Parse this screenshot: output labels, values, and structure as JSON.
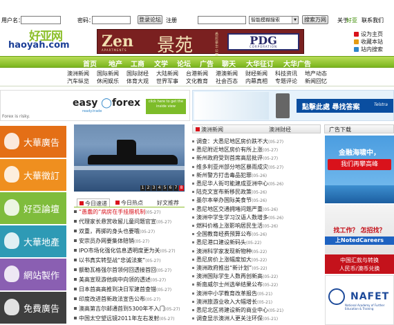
{
  "login": {
    "username_label": "用户名：",
    "password_label": "密码：",
    "login_button": "登录论坛",
    "register_link": "注册",
    "search_select": "智能模糊搜索",
    "search_button": "搜索万网",
    "about_label": "关于",
    "about_link": "好亚",
    "contact_link": "联系我们"
  },
  "logo": {
    "cn": "好亚网",
    "en": "haoyah.com"
  },
  "banner": {
    "zen_en": "Zen",
    "zen_sub": "APARTMENTS",
    "zen_cn": "景苑",
    "zen_vertical": "悉尼豪华公寓",
    "pdg_title": "PDG",
    "pdg_sub": "CORPORATION"
  },
  "quick_links": [
    "设为主页",
    "收藏本站",
    "站内搜索"
  ],
  "nav": [
    "首页",
    "地产",
    "工商",
    "文学",
    "论坛",
    "广告",
    "聊天",
    "大华征订",
    "大华广告"
  ],
  "subnav": {
    "row1": [
      "澳洲新闻",
      "国际新闻",
      "国际财经",
      "大陆新闻",
      "台港新闻",
      "港澳新闻",
      "财经新闻",
      "科技资讯",
      "地产动态"
    ],
    "row2": [
      "汽车纵览",
      "休闲娱乐",
      "体育大观",
      "世界军事",
      "文化教育",
      "社会百态",
      "内幕真相",
      "专题评论",
      "新闻回忆"
    ]
  },
  "forex_ad": {
    "brand_a": "easy",
    "brand_b": "forex",
    "tagline": "ready.trade",
    "cta": "click here to get the inside view",
    "risk": "Forex is risky."
  },
  "telstra_ad": {
    "text": "點擊此處 尋找答案",
    "brand": "Telstra"
  },
  "left_menu": [
    {
      "label": "大華廣告",
      "color": "#e46f16"
    },
    {
      "label": "大華徵訂",
      "color": "#ef8f1f"
    },
    {
      "label": "好亞論壇",
      "color": "#7fbc3c"
    },
    {
      "label": "大華地產",
      "color": "#2e9ab5"
    },
    {
      "label": "網站製作",
      "color": "#8a5fb2"
    },
    {
      "label": "免費廣告",
      "color": "#3f3f3f"
    }
  ],
  "photo": {
    "pages": [
      "1",
      "2",
      "3",
      "4",
      "5",
      "6",
      "7",
      "8"
    ],
    "active_page": "8"
  },
  "left_tabs": [
    "今日速递",
    "今日热点",
    "好文推荐"
  ],
  "left_news": [
    {
      "title": "“愚蠢的”病房在手挂腊机制",
      "date": "(05-27)"
    },
    {
      "title": "代理家长悬赏收留儿童问题官宣",
      "date": "(05-27)"
    },
    {
      "title": "双重，再掷的身头也要哦",
      "date": "(05-27)"
    },
    {
      "title": "安宗员办网要集体赔销",
      "date": "(05-27)"
    },
    {
      "title": "IPO市场化强化信息透明度更为关",
      "date": "(05-27)"
    },
    {
      "title": "以书真实转型战“忠诚法案”",
      "date": "(05-27)"
    },
    {
      "title": "额勒瓦格强尔首领何回透接首回",
      "date": "(05-27)"
    },
    {
      "title": "美高宣现游他病中向领的透述",
      "date": "(05-27)"
    },
    {
      "title": "日本首高高推到决日军建首查错",
      "date": "(05-27)"
    },
    {
      "title": "印度改进首新政法宣告公布",
      "date": "(05-27)"
    },
    {
      "title": "澳高第吉尔邮通首到5300年不入门",
      "date": "(05-27)"
    },
    {
      "title": "中国太空望远镜2011年左右发射",
      "date": "(05-27)"
    }
  ],
  "mid_tabs": [
    "澳洲新闻",
    "澳洲财经"
  ],
  "mid_news": [
    {
      "title": "调查：大悉尼地区房价跌不大",
      "date": "(05-27)"
    },
    {
      "title": "悉尼附近地区房价有所上涨",
      "date": "(05-27)"
    },
    {
      "title": "新州政府受到首席高层批评",
      "date": "(05-27)"
    },
    {
      "title": "维多利亚州部分地区暴雨成灾",
      "date": "(05-27)"
    },
    {
      "title": "新州警方打击毒品犯罪",
      "date": "(05-26)"
    },
    {
      "title": "悉尼华人街可能建成亚洲中心",
      "date": "(05-26)"
    },
    {
      "title": "陆克文宣布新移民政策",
      "date": "(05-26)"
    },
    {
      "title": "墨尔本举办国际美食节",
      "date": "(05-26)"
    },
    {
      "title": "悉尼地区交通拥堵问题严重",
      "date": "(05-26)"
    },
    {
      "title": "澳洲中学生学习汉语人数增多",
      "date": "(05-26)"
    },
    {
      "title": "燃料价格上涨影响居民生活",
      "date": "(05-26)"
    },
    {
      "title": "全国教育经费预算公布",
      "date": "(05-26)"
    },
    {
      "title": "悉尼港口建设新码头",
      "date": "(05-22)"
    },
    {
      "title": "澳洲科学家发现新物种",
      "date": "(05-22)"
    },
    {
      "title": "悉尼房价上涨幅度加大",
      "date": "(05-22)"
    },
    {
      "title": "澳洲政府推出“新计划”",
      "date": "(05-22)"
    },
    {
      "title": "澳洲国际学生人数再创新高",
      "date": "(05-22)"
    },
    {
      "title": "新南威尔士州选举结果公布",
      "date": "(05-22)"
    },
    {
      "title": "澳洲中小学教育改革报告",
      "date": "(05-21)"
    },
    {
      "title": "澳洲旅游业收入大幅增长",
      "date": "(05-21)"
    },
    {
      "title": "悉尼北区将建设新的商业中心",
      "date": "(05-21)"
    },
    {
      "title": "调查显示澳洲人更关注环保",
      "date": "(05-21)"
    }
  ],
  "ads_header": "广告下载",
  "ad1": {
    "line1": "金融海啸中，",
    "line2": "我们再攀高峰"
  },
  "ad2": {
    "line1": "找工作？ 怎招找？",
    "line2": "上NotedCareers",
    "line3": "中国汇款与转换",
    "line4": "人民币/澳币兑换"
  },
  "ad3": {
    "brand": "NAFET",
    "sub": "National Academy of Further Education & Training"
  },
  "colors": {
    "nav_green": "#8cbf2a",
    "news_red": "#d9121b",
    "logo_blue": "#1c3f96"
  }
}
